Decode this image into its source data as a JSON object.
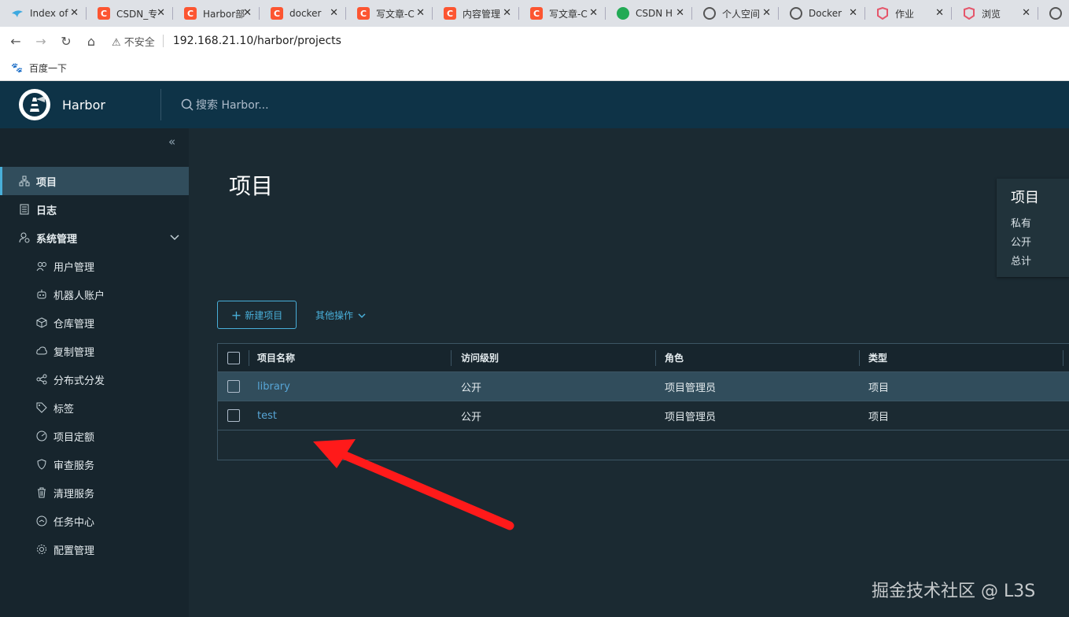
{
  "browser": {
    "tabs": [
      {
        "title": "Index of",
        "favicon": "harbor-favicon-icon"
      },
      {
        "title": "CSDN_专",
        "favicon": "csdn-favicon-icon"
      },
      {
        "title": "Harbor部",
        "favicon": "csdn-favicon-icon"
      },
      {
        "title": "docker",
        "favicon": "csdn-favicon-icon"
      },
      {
        "title": "写文章-C",
        "favicon": "csdn-favicon-icon"
      },
      {
        "title": "内容管理",
        "favicon": "csdn-favicon-icon"
      },
      {
        "title": "写文章-C",
        "favicon": "csdn-favicon-icon"
      },
      {
        "title": "CSDN H",
        "favicon": "csdn-chat-favicon-icon"
      },
      {
        "title": "个人空间",
        "favicon": "globe-icon"
      },
      {
        "title": "Docker",
        "favicon": "globe-icon"
      },
      {
        "title": "作业",
        "favicon": "app-favicon-icon"
      },
      {
        "title": "浏览",
        "favicon": "app-favicon-icon"
      },
      {
        "title": "",
        "favicon": "globe-icon"
      }
    ],
    "not_secure_label": "不安全",
    "url": "192.168.21.10/harbor/projects",
    "bookmark": "百度一下"
  },
  "header": {
    "brand": "Harbor",
    "search_placeholder": "搜索 Harbor..."
  },
  "sidebar": {
    "collapse_glyph": "«",
    "items": [
      {
        "label": "项目",
        "icon": "projects-icon",
        "active": true
      },
      {
        "label": "日志",
        "icon": "logs-icon"
      },
      {
        "label": "系统管理",
        "icon": "admin-icon"
      },
      {
        "label": "用户管理",
        "icon": "users-icon"
      },
      {
        "label": "机器人账户",
        "icon": "robot-icon"
      },
      {
        "label": "仓库管理",
        "icon": "registry-icon"
      },
      {
        "label": "复制管理",
        "icon": "replication-icon"
      },
      {
        "label": "分布式分发",
        "icon": "distribution-icon"
      },
      {
        "label": "标签",
        "icon": "tag-icon"
      },
      {
        "label": "项目定额",
        "icon": "quota-icon"
      },
      {
        "label": "审查服务",
        "icon": "shield-icon"
      },
      {
        "label": "清理服务",
        "icon": "trash-icon"
      },
      {
        "label": "任务中心",
        "icon": "dashboard-icon"
      },
      {
        "label": "配置管理",
        "icon": "gear-icon"
      }
    ]
  },
  "main": {
    "title": "项目",
    "summary": {
      "title": "项目",
      "rows": [
        "私有",
        "公开",
        "总计"
      ]
    },
    "new_project_label": "新建项目",
    "more_actions_label": "其他操作",
    "table": {
      "headers": [
        "项目名称",
        "访问级别",
        "角色",
        "类型"
      ],
      "rows": [
        [
          "library",
          "公开",
          "项目管理员",
          "项目"
        ],
        [
          "test",
          "公开",
          "项目管理员",
          "项目"
        ]
      ]
    }
  },
  "watermark": "掘金技术社区 @ L3S",
  "colors": {
    "header_bg": "#0e3347",
    "sidebar_bg": "#17252d",
    "main_bg": "#1b2a32",
    "accent": "#49afd9",
    "arrow": "#ff1a1a"
  }
}
